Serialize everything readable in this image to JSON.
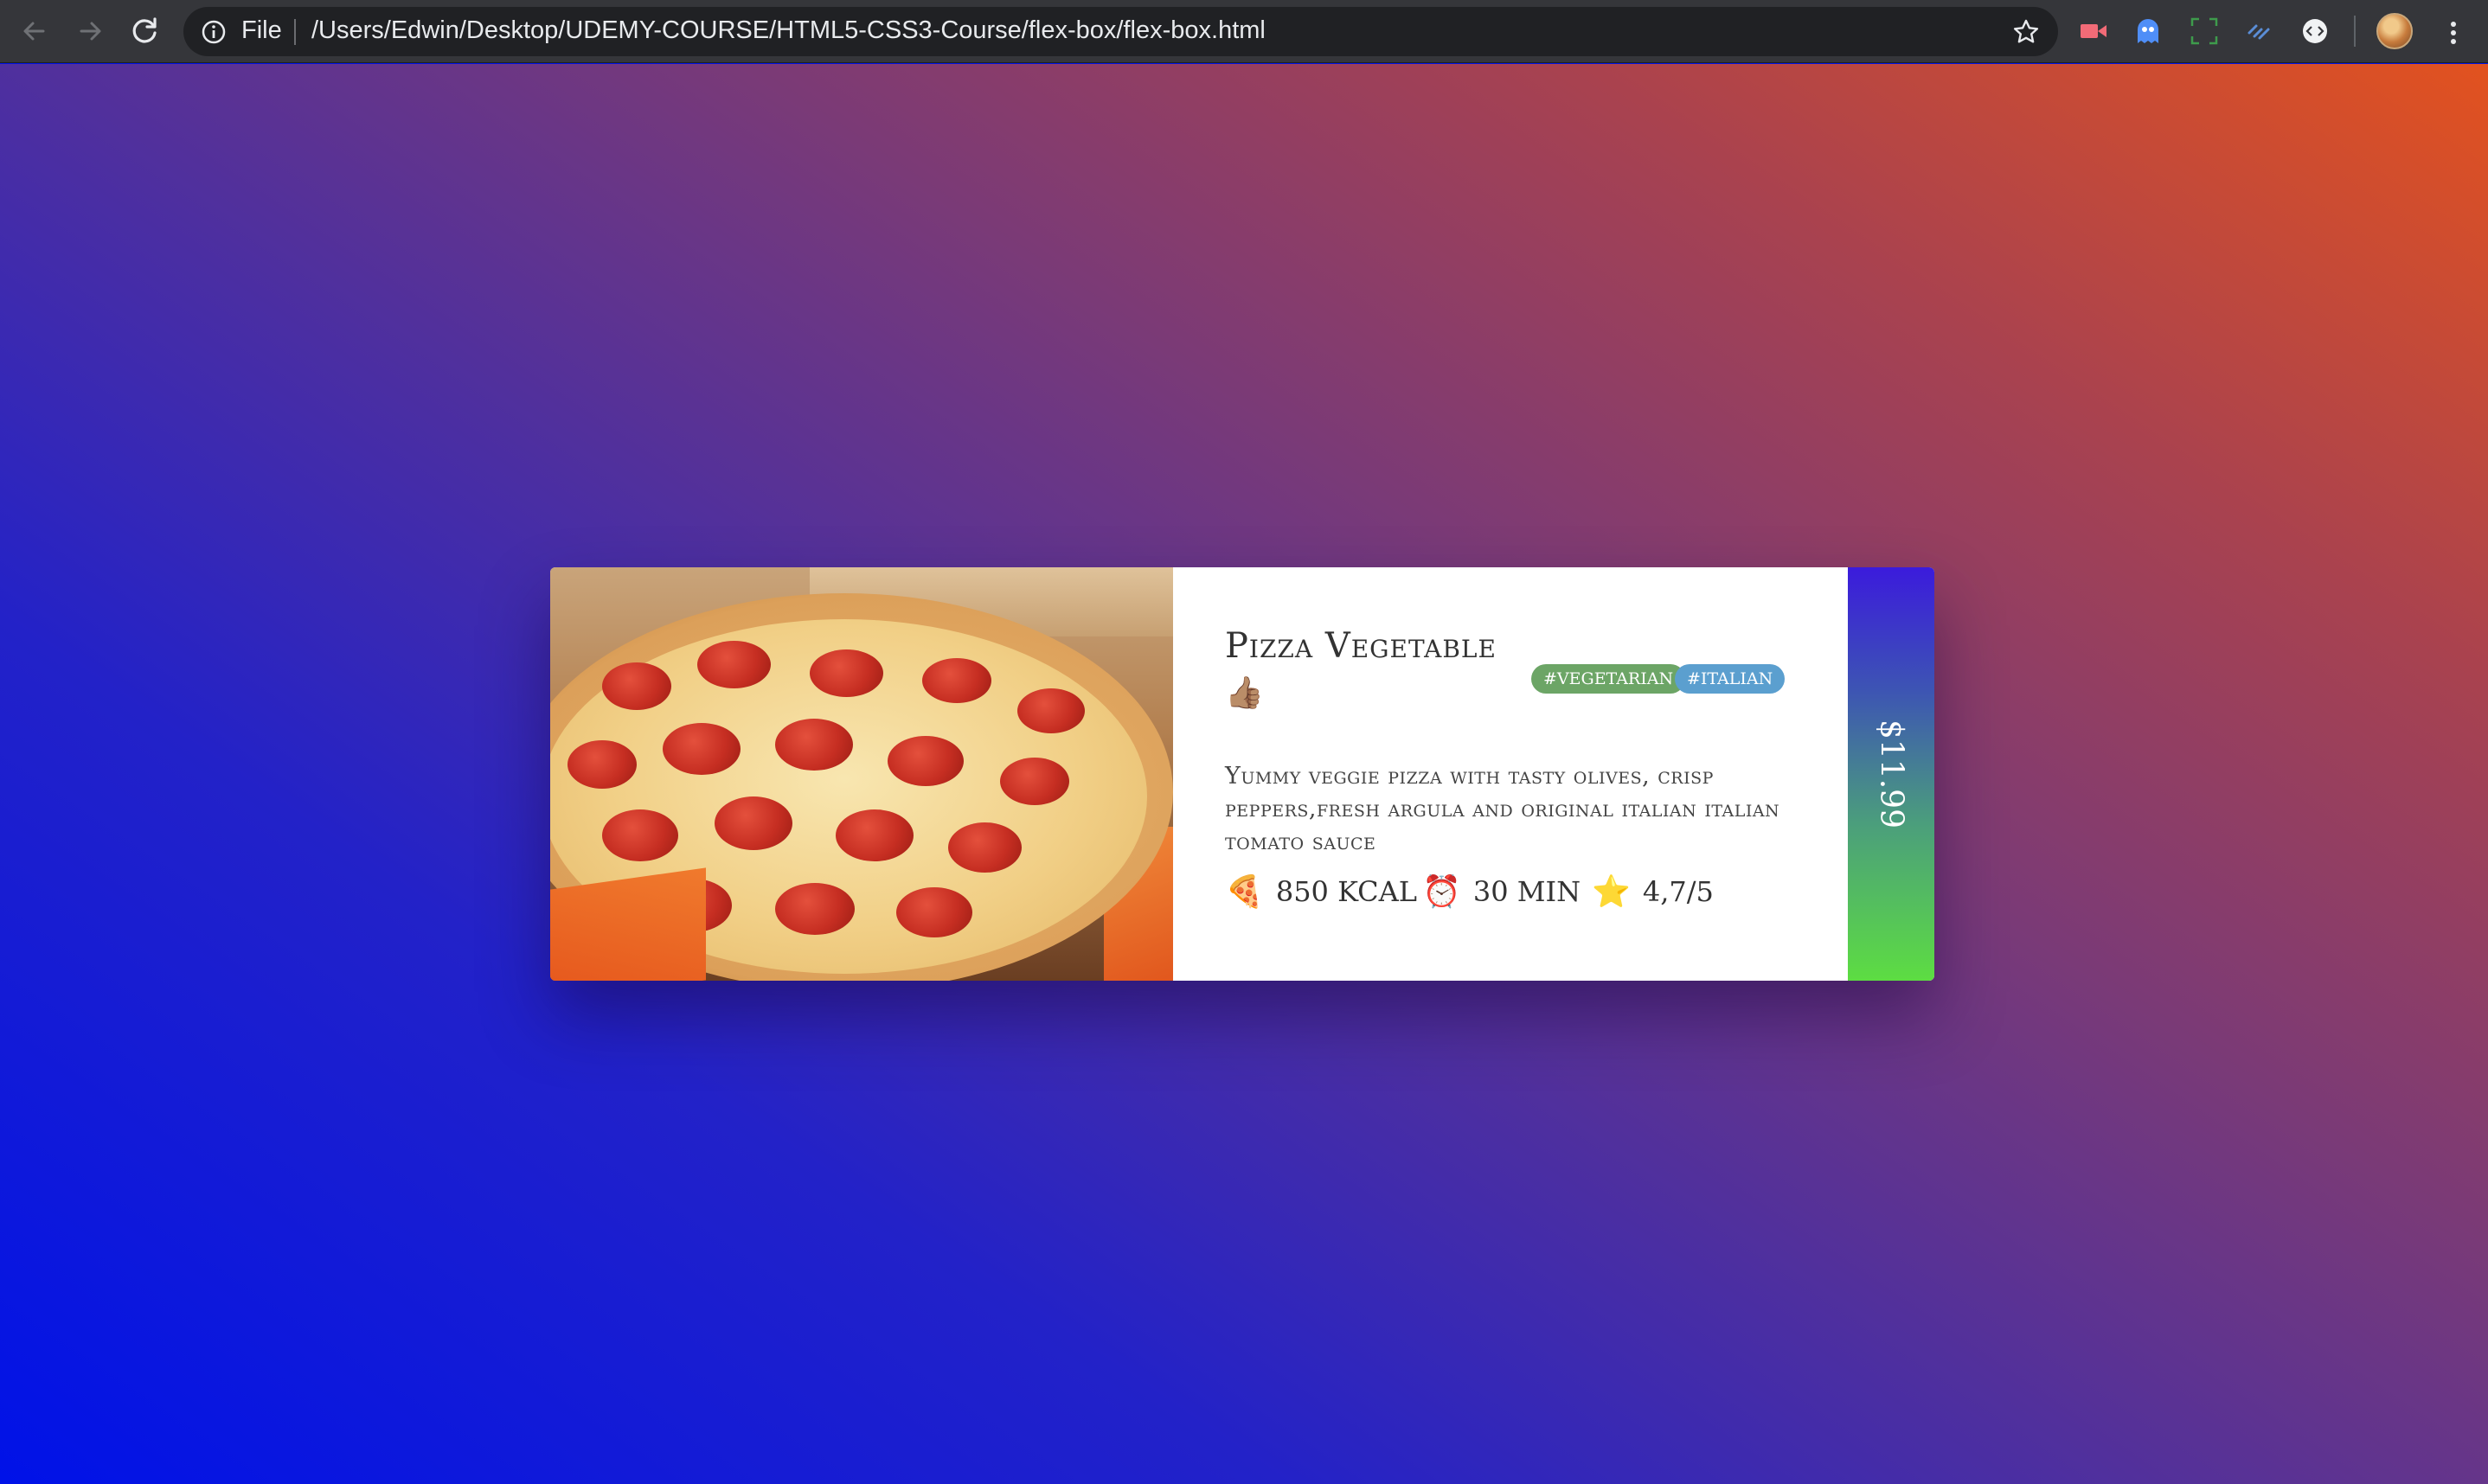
{
  "browser": {
    "scheme_label": "File",
    "url": "/Users/Edwin/Desktop/UDEMY-COURSE/HTML5-CSS3-Course/flex-box/flex-box.html",
    "icons": [
      "back-arrow-icon",
      "forward-arrow-icon",
      "reload-icon",
      "info-icon",
      "star-icon",
      "kebab-menu-icon"
    ]
  },
  "card": {
    "title": "Pizza Vegetable",
    "title_emoji": "👍🏽",
    "tags": [
      "#VEGETARIAN",
      "#ITALIAN"
    ],
    "description": "Yummy veggie pizza with tasty olives, crisp peppers,fresh argula and original italian italian tomato sauce",
    "stats": [
      {
        "icon": "🍕",
        "text": "850 KCAL"
      },
      {
        "icon": "⏰",
        "text": "30 MIN"
      },
      {
        "icon": "⭐",
        "text": "4,7/5"
      }
    ],
    "price": "$11.99",
    "colors": {
      "tag_vegetarian": "#6ca566",
      "tag_italian": "#5b9fcf",
      "price_gradient_top": "#3b1bdc",
      "price_gradient_bottom": "#5ddd42"
    }
  }
}
